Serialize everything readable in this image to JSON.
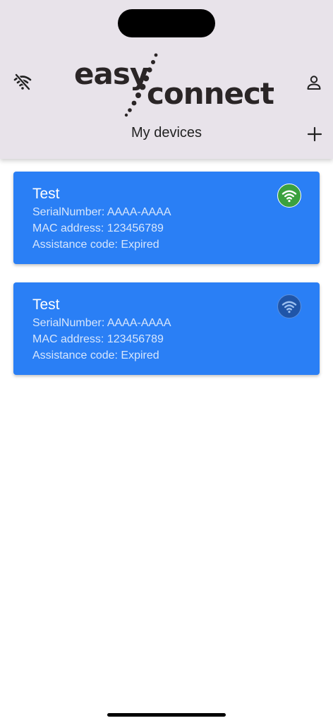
{
  "app": {
    "logo_word_1": "easy",
    "logo_word_2": "connect",
    "title": "My devices"
  },
  "icons": {
    "left": "wifi-off-icon",
    "right_top": "person-icon",
    "right_bottom": "plus-icon"
  },
  "devices": [
    {
      "name": "Test",
      "serial": "SerialNumber: AAAA-AAAA",
      "mac": "MAC address: 123456789",
      "assistance": "Assistance code: Expired",
      "status_icon": "wifi-icon",
      "status": "online",
      "status_color": "#3ba13f"
    },
    {
      "name": "Test",
      "serial": "SerialNumber: AAAA-AAAA",
      "mac": "MAC address: 123456789",
      "assistance": "Assistance code: Expired",
      "status_icon": "wifi-icon",
      "status": "offline",
      "status_color": "#1f55a8"
    }
  ],
  "colors": {
    "header_bg": "#e8e3ea",
    "card_bg": "#2a7ff5"
  }
}
